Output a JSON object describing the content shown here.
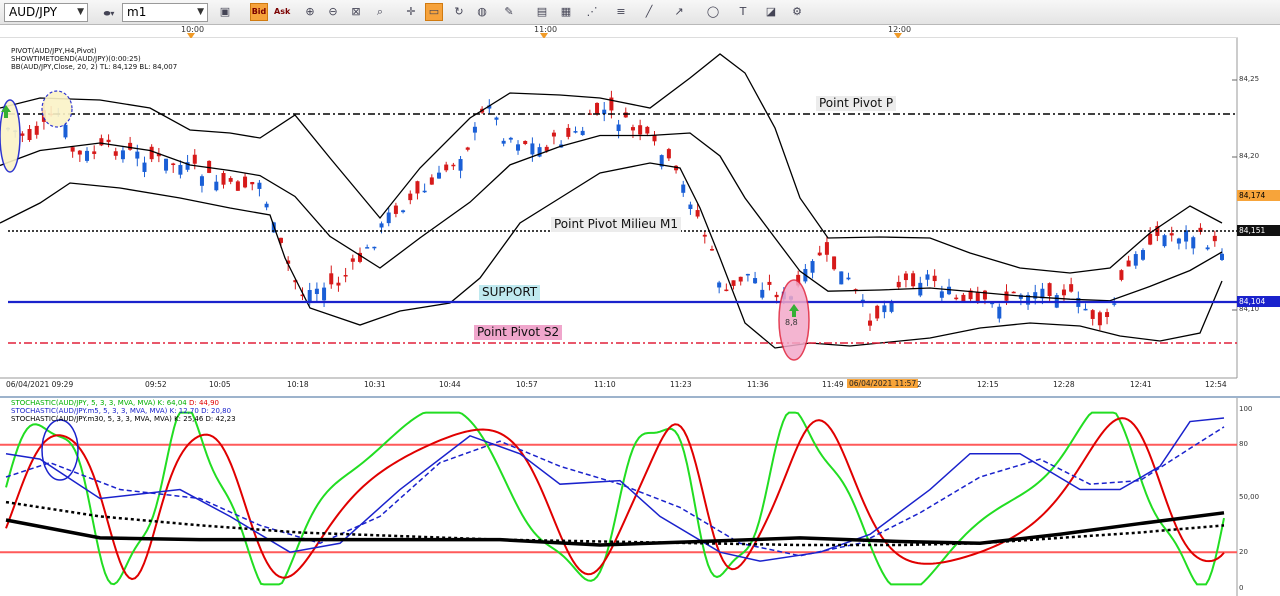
{
  "toolbar": {
    "symbol": "AUD/JPY",
    "timeframe": "m1",
    "bid_label": "Bid",
    "ask_label": "Ask"
  },
  "timebar": {
    "labels": [
      "10:00",
      "11:00",
      "12:00"
    ]
  },
  "main_chart": {
    "legend": [
      "PIVOT(AUD/JPY,H4,Pivot)",
      "SHOWTIMETOEND(AUD/JPY)(0:00:25)",
      "BB(AUD/JPY,Close, 20, 2)  TL: 84,129  BL: 84,007"
    ],
    "annotations": {
      "pivot_p": "Point Pivot P",
      "pivot_m1": "Point Pivot Milieu M1",
      "support": "SUPPORT",
      "pivot_s2": "Point Pivot S2",
      "marker_value": "8,8"
    },
    "y_axis": [
      "84,25",
      "84,20",
      "84,10"
    ],
    "price_tags": {
      "upper": "84,174",
      "current": "84,151",
      "support": "84,104"
    },
    "x_axis": [
      "06/04/2021 09:29",
      "09:52",
      "10:05",
      "10:18",
      "10:31",
      "10:44",
      "10:57",
      "11:10",
      "11:23",
      "11:36",
      "11:49",
      "12:15",
      "12:28",
      "12:41",
      "12:54"
    ],
    "cursor_time": "06/04/2021 11:57",
    "cursor_tail": "2",
    "colors": {
      "bull": "#1a5fd6",
      "bear": "#d61a1a",
      "support": "#1a22cc",
      "s2": "#e0203a",
      "bands": "#000000"
    }
  },
  "stoch_panel": {
    "legend": [
      {
        "text": "STOCHASTIC(AUD/JPY, 5, 3, 3, MVA, MVA)  K: 64,04  ",
        "extra": "D: 44,90",
        "color": "#00b000",
        "extra_color": "#e00000"
      },
      {
        "text": "STOCHASTIC(AUD/JPY.m5, 5, 3, 3, MVA, MVA)  K: 12,70  D: 20,80",
        "extra": "",
        "color": "#1a22cc",
        "extra_color": "#1a22cc"
      },
      {
        "text": "STOCHASTIC(AUD/JPY.m30, 5, 3, 3, MVA, MVA)  K: 25,46  D: 42,23",
        "extra": "",
        "color": "#000000",
        "extra_color": "#000000"
      }
    ],
    "y_axis": [
      "100",
      "80",
      "50,00",
      "20",
      "0"
    ],
    "levels": {
      "upper": 80,
      "lower": 20
    },
    "colors": {
      "k_fast": "#22dd22",
      "d_fast": "#e00000",
      "m5": "#1a22cc",
      "m30": "#000000",
      "levels": "#ff5a5a"
    }
  }
}
